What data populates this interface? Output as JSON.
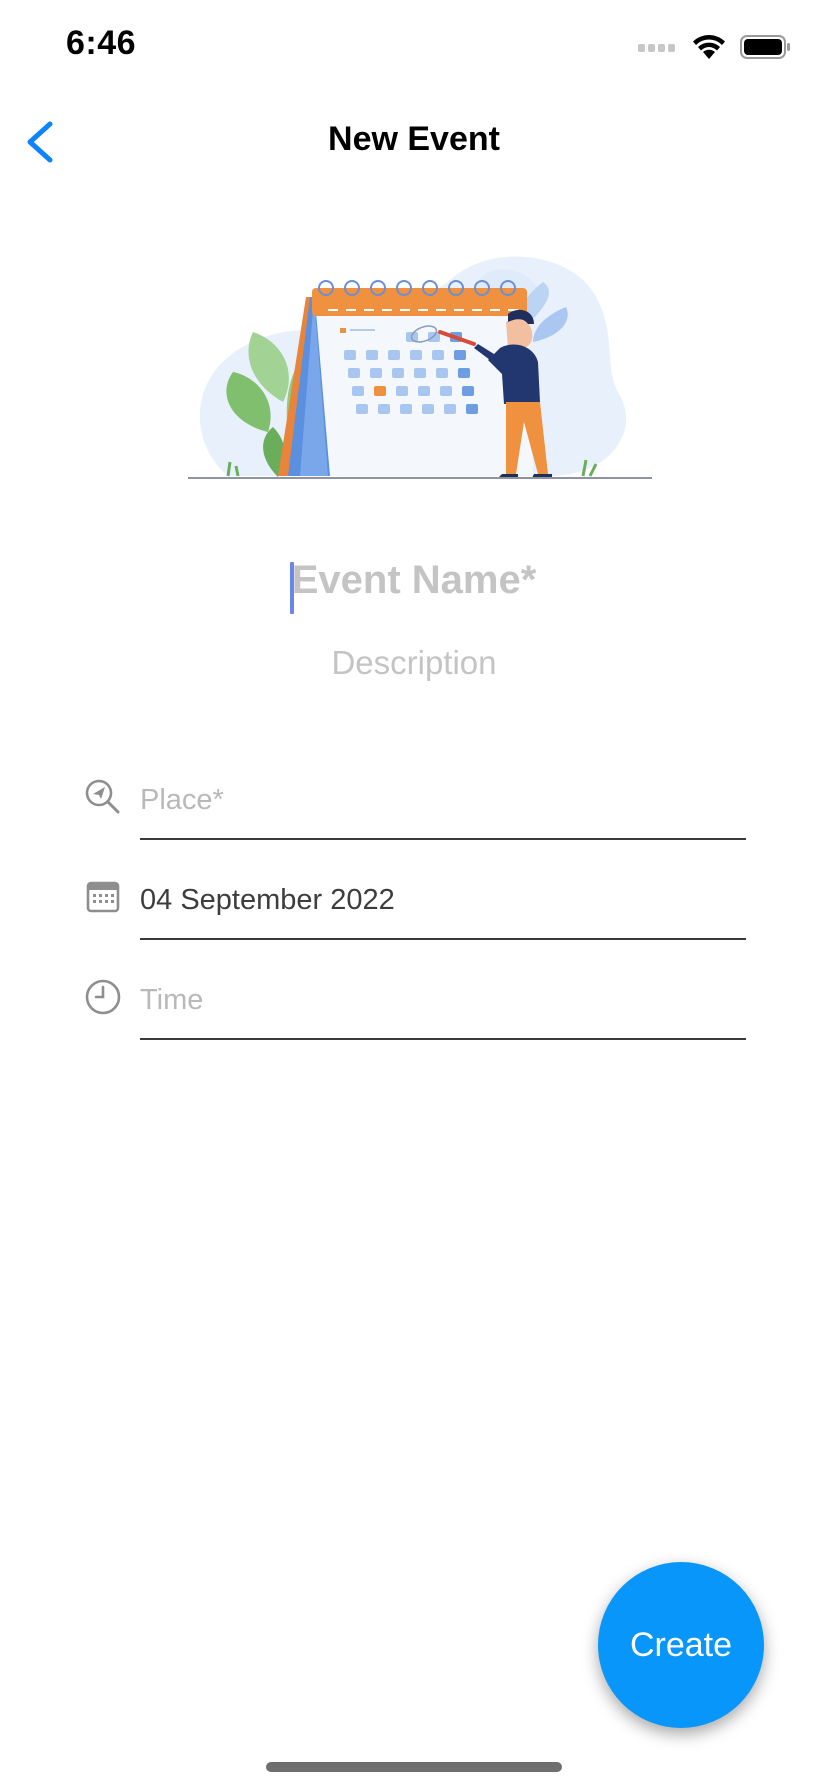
{
  "status_bar": {
    "time": "6:46"
  },
  "nav": {
    "title": "New Event",
    "back_icon": "chevron-left-icon",
    "accent_color": "#0a84ff"
  },
  "form": {
    "event_name_placeholder": "Event Name*",
    "description_placeholder": "Description",
    "place": {
      "icon": "location-search-icon",
      "placeholder": "Place*",
      "value": ""
    },
    "date": {
      "icon": "calendar-icon",
      "value": "04 September 2022"
    },
    "time": {
      "icon": "clock-icon",
      "placeholder": "Time",
      "value": ""
    }
  },
  "actions": {
    "create_label": "Create",
    "create_color": "#0996fb"
  }
}
